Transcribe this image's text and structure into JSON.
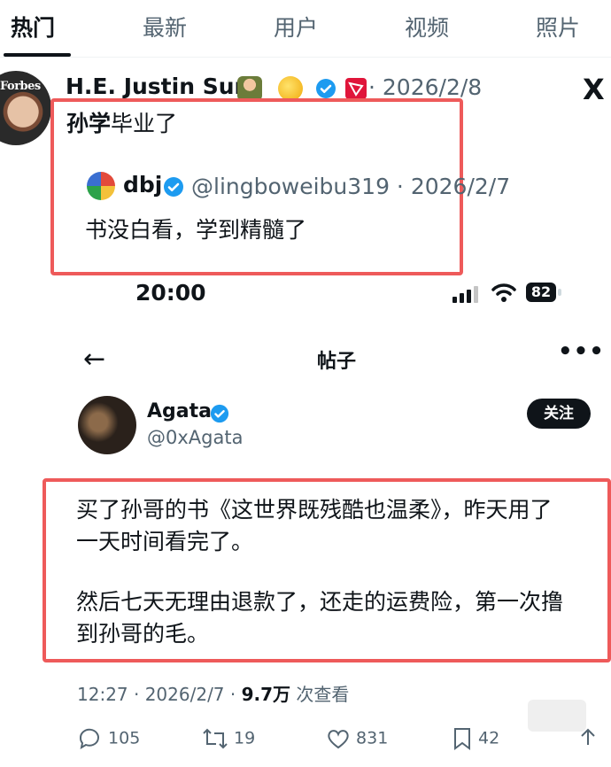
{
  "tabs": [
    "热门",
    "最新",
    "用户",
    "视频",
    "照片"
  ],
  "tweet1": {
    "avatar_text": "Forbes",
    "name": "H.E. Justin Sun",
    "date": "· 2026/2/8",
    "text_bold": "孙学",
    "text_rest": "毕业了",
    "x_logo": "X"
  },
  "quote": {
    "name": "dbj",
    "handle": "@lingboweibu319 · 2026/2/7",
    "text": "书没白看，学到精髓了"
  },
  "status_bar": {
    "time": "20:00",
    "battery": "82"
  },
  "post": {
    "title": "帖子",
    "author_name": "Agata",
    "author_handle": "@0xAgata",
    "follow_label": "关注",
    "lines": [
      "买了孙哥的书《这世界既残酷也温柔》，昨天用了",
      "一天时间看完了。",
      "然后七天无理由退款了，还走的运费险，第一次撸",
      "到孙哥的毛。"
    ],
    "meta_time": "12:27 · 2026/2/7 · ",
    "meta_views": "9.7万",
    "meta_views_label": " 次查看",
    "replies": "105",
    "reposts": "19",
    "likes": "831",
    "bookmarks": "42"
  },
  "colors": {
    "highlight_border": "#ee5a5a",
    "verified_blue": "#1d9bf0",
    "muted_text": "#536471"
  }
}
